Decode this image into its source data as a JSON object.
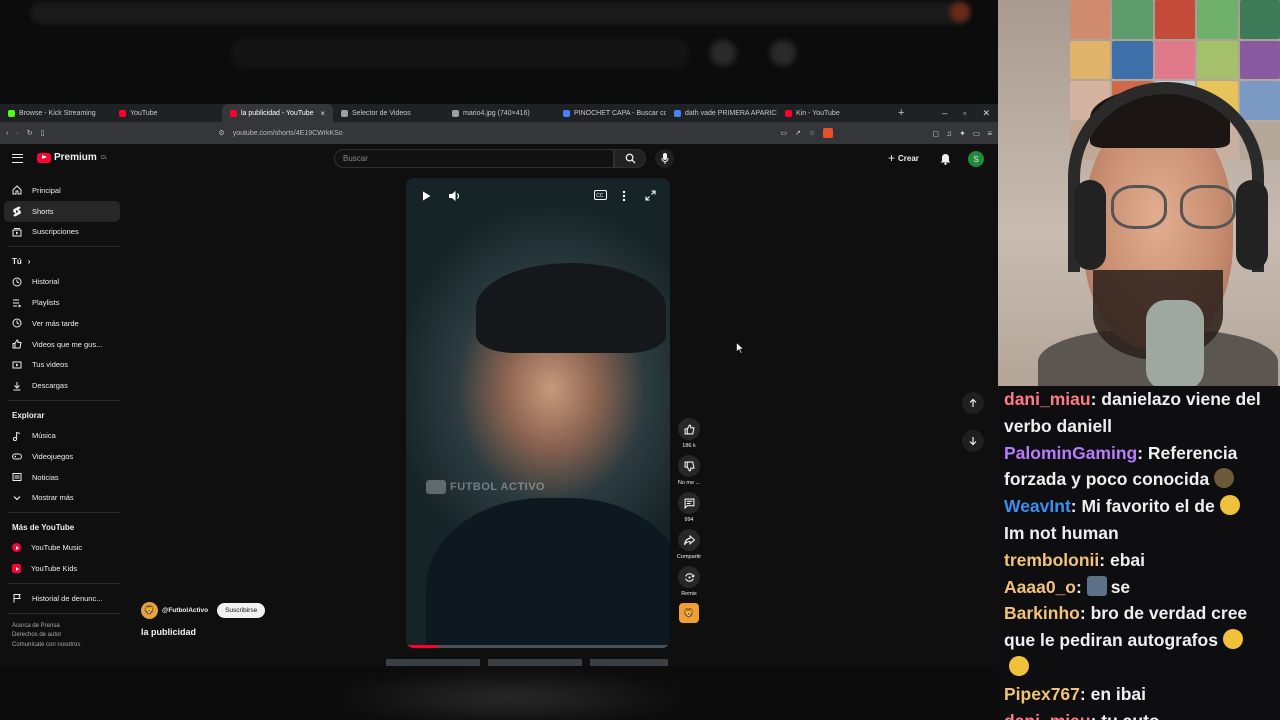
{
  "browser": {
    "tabs": [
      {
        "label": "Browse - Kick Streaming",
        "color": "#53fc18"
      },
      {
        "label": "YouTube",
        "color": "#ff0033"
      },
      {
        "label": "la publicidad - YouTube",
        "color": "#ff0033",
        "active": true
      },
      {
        "label": "Selector de Videos",
        "color": "#9aa0a6"
      },
      {
        "label": "mario4.jpg (740×416)",
        "color": "#9aa0a6"
      },
      {
        "label": "PINOCHET CAPA - Buscar con",
        "color": "#4285f4"
      },
      {
        "label": "dath vade PRIMERA APARICIO",
        "color": "#4285f4"
      },
      {
        "label": "Kin - YouTube",
        "color": "#ff0033"
      }
    ],
    "url": "youtube.com/shorts/4E19CWrkKSo"
  },
  "youtube": {
    "logo": "Premium",
    "logo_country": "CL",
    "search_placeholder": "Buscar",
    "create_label": "Crear",
    "avatar_letter": "S",
    "nav_main": [
      "Principal",
      "Shorts",
      "Suscripciones"
    ],
    "you_label": "Tú",
    "nav_you": [
      "Historial",
      "Playlists",
      "Ver más tarde",
      "Videos que me gus...",
      "Tus videos",
      "Descargas"
    ],
    "explore_label": "Explorar",
    "nav_explore": [
      "Música",
      "Videojuegos",
      "Noticias",
      "Mostrar más"
    ],
    "more_label": "Más de YouTube",
    "nav_more": [
      "YouTube Music",
      "YouTube Kids"
    ],
    "report_history": "Historial de denunc...",
    "footer": [
      "Acerca de   Prensa",
      "Derechos de autor",
      "Comunícate con nosotros"
    ]
  },
  "short": {
    "watermark": "FUTBOL ACTIVO",
    "likes": "186 k",
    "dislike_label": "No me ...",
    "comments": "994",
    "share_label": "Compartir",
    "remix_label": "Remix",
    "channel": "@FutbolActivo",
    "subscribe_label": "Suscribirse",
    "title": "la publicidad",
    "progress": 0.12
  },
  "chat": [
    {
      "user": "dani_miau",
      "color": "#ff7a85",
      "text": "danielazo viene del verbo daniell"
    },
    {
      "user": "PalominGaming",
      "color": "#b87cff",
      "text": "Referencia forzada y poco conocida",
      "emote": "#6b5a3a"
    },
    {
      "user": "WeavInt",
      "color": "#3e8df0",
      "text": "Mi favorito el de",
      "emote": "#f0c23c",
      "after": "Im not human"
    },
    {
      "user": "trembolonii",
      "color": "#f2c27a",
      "text": "ebai"
    },
    {
      "user": "Aaaa0_o",
      "color": "#f2c27a",
      "text": "se",
      "pre_emote": "#5d7088"
    },
    {
      "user": "Barkinho",
      "color": "#f2c27a",
      "text": "bro de verdad cree que le pediran autografos",
      "emote": "#f0c23c"
    },
    {
      "user": "",
      "color": "#f2c27a",
      "text": "",
      "emote": "#f0c23c"
    },
    {
      "user": "Pipex767",
      "color": "#f2c27a",
      "text": "en ibai"
    },
    {
      "user": "dani_miau",
      "color": "#ff7a85",
      "text": "tu auto"
    }
  ]
}
